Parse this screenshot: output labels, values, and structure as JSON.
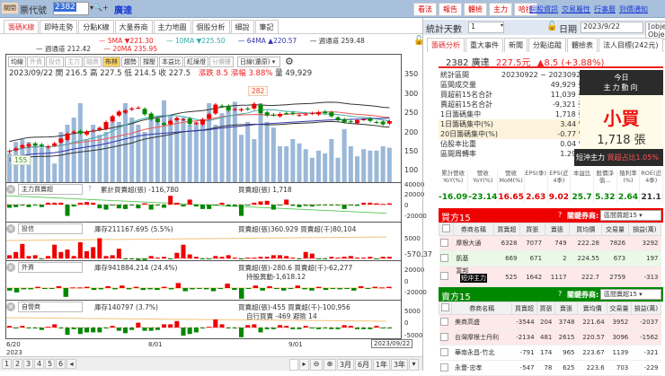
{
  "topbar": {
    "close_label": "關閉",
    "code_label": "票代號",
    "code_value": "2382",
    "stock_name": "廣達",
    "buttons": [
      "看法",
      "報告",
      "體檢",
      "主力",
      "哈拉"
    ],
    "links": [
      "個股資訊",
      "交易屬性",
      "行事曆",
      "到價通知"
    ]
  },
  "left_tabs": [
    "籌碼K線",
    "即時走勢",
    "分點K線",
    "大量券商",
    "主力地圖",
    "個股分析",
    "細說",
    "筆記"
  ],
  "ma_legend": {
    "ma5": "5MA ▼221.30",
    "ma10": "10MA ▼225.50",
    "ma64": "64MA ▲220.57",
    "upper": "週通道 259.48",
    "lower": "週通道 212.42",
    "ma20": "20MA 235.95"
  },
  "toolbar": {
    "buttons": [
      "均線",
      "外資",
      "投信",
      "主力",
      "融資",
      "布林",
      "趨勢",
      "撐壓",
      "本益比",
      "紅綠燈",
      "分價樓"
    ],
    "period": "日線(還原)"
  },
  "ohlc": {
    "date": "2023/09/22",
    "open_label": "開",
    "open": "216.5",
    "high_label": "高",
    "high": "227.5",
    "low_label": "低",
    "low": "214.5",
    "close_label": "收",
    "close": "227.5",
    "chg_label": "漲跌",
    "chg": "8.5",
    "pct_label": "漲幅",
    "pct": "3.88%",
    "vol_label": "量",
    "vol": "49,929"
  },
  "price_axis": [
    "350",
    "300",
    "250",
    "200",
    "150",
    "100"
  ],
  "markers": {
    "high": "282",
    "low": "155"
  },
  "chart_data": {
    "type": "candlestick",
    "ylim": [
      85,
      350
    ],
    "close": [
      150,
      157,
      165,
      168,
      165,
      163,
      162,
      170,
      182,
      195,
      200,
      196,
      200,
      203,
      210,
      225,
      240,
      252,
      255,
      260,
      262,
      245,
      232,
      225,
      218,
      228,
      235,
      232,
      220,
      222,
      232,
      245,
      270,
      265,
      255,
      258,
      258,
      258,
      272,
      248,
      242,
      243,
      246,
      247,
      246,
      243,
      245,
      248,
      250,
      248,
      240,
      230,
      225,
      225,
      230,
      232,
      228,
      224,
      219,
      227.5
    ],
    "volume": [
      20,
      28,
      30,
      28,
      26,
      24,
      25,
      13,
      35,
      40,
      45,
      55,
      30,
      40,
      33,
      35,
      45,
      42,
      55,
      45,
      40,
      35,
      45,
      45,
      57,
      47,
      45,
      45,
      40,
      42,
      42,
      55,
      40,
      48,
      52,
      56,
      33,
      42,
      30,
      55,
      42,
      38,
      25,
      25,
      30,
      27,
      23,
      17,
      22,
      20,
      30,
      17,
      37,
      25,
      18,
      23,
      22,
      22,
      25,
      24
    ],
    "xticks": [
      "6/20\n2023",
      "8/01",
      "9/01",
      "2023/09/22"
    ]
  },
  "sub": {
    "main": {
      "select": "主力買賣超",
      "legend1": "累計買賣超(張) -116,780",
      "legend2": "買賣超(張) 1,718",
      "axis": [
        "40000",
        "20000",
        "0",
        "-20000"
      ],
      "values": [
        -5,
        -4,
        0,
        -4,
        0,
        -4,
        3,
        3,
        3,
        -18,
        -3,
        3,
        4,
        3,
        -6,
        -8,
        0,
        -6,
        -7,
        0,
        -6,
        2,
        -8,
        0,
        -5,
        14,
        3,
        -3,
        8,
        -3,
        -7,
        -7,
        0,
        3,
        -3,
        -3,
        -18,
        0,
        3,
        5,
        6,
        -8,
        0,
        8,
        -2,
        -4,
        -2,
        -3,
        0,
        0,
        0,
        0,
        -7,
        0,
        -2,
        3,
        3,
        2,
        1,
        2
      ]
    },
    "trust": {
      "select": "投信",
      "legend1": "庫存211167.695 (5.5%)",
      "legend2": "買賣超(張)360.929 買賣超(千)80,104",
      "axis": [
        "5000",
        "-570.37"
      ],
      "values": [
        4,
        8,
        18,
        3,
        4,
        -1,
        3,
        17,
        8,
        11,
        3,
        20,
        9,
        14,
        25,
        3,
        4,
        12,
        -1,
        -1,
        -2,
        -2,
        3,
        1,
        2,
        -1,
        7,
        17,
        5,
        2,
        -1,
        -1,
        3,
        2,
        4,
        1,
        -1,
        1,
        1,
        2,
        2,
        4,
        4,
        3,
        1,
        -1,
        8,
        6,
        -1,
        -1,
        2,
        1,
        2,
        3,
        1,
        1,
        2,
        -1,
        2,
        2
      ]
    },
    "foreign": {
      "select": "外資",
      "legend1": "庫存941884.214 (24.4%)",
      "legend2": "買賣超(張)-280.6 買賣超(千)-62,277",
      "legend3": "持股異動-1,618.12",
      "axis": [
        "20000",
        "0",
        "-20000"
      ],
      "values": [
        -4,
        -7,
        -2,
        -2,
        2,
        0,
        -1,
        3,
        -14,
        1,
        1,
        2,
        -3,
        -2,
        3,
        -2,
        4,
        -2,
        2,
        -3,
        -2,
        -3,
        2,
        -2,
        8,
        -5,
        -2,
        0,
        -2,
        -5,
        -1,
        7,
        -3,
        -17,
        0,
        4,
        -4,
        3,
        -1,
        -4,
        0,
        4,
        -2,
        -4,
        2,
        -3,
        -1,
        -2,
        -1,
        -4,
        3,
        -1,
        2,
        1,
        2
      ]
    },
    "dealer": {
      "select": "自營商",
      "legend1": "庫存140797 (3.7%)",
      "legend2": "買賣超(張)-455 買賣超(千)-100,956",
      "legend3": "自行買賣 -469 避險 14",
      "axis": [
        "5000",
        "0",
        "-5000"
      ],
      "values": [
        2,
        -1,
        2,
        -1,
        -1,
        -3,
        1,
        4,
        -1,
        -9,
        -2,
        -8,
        -6,
        -6,
        -6,
        0,
        2,
        -4,
        -7,
        -3,
        6,
        -4,
        -4,
        -3,
        4,
        4,
        8,
        -10,
        -8,
        -6,
        0,
        1,
        10,
        4,
        0,
        -1,
        -12,
        3,
        4,
        -6,
        -2,
        -2,
        3,
        2,
        -2,
        -2,
        2,
        -1,
        -2,
        -1,
        -2,
        -2,
        3,
        2,
        -2,
        -2,
        -2,
        2,
        -1,
        -1
      ]
    }
  },
  "xaxis": {
    "start": "6/20\n2023",
    "mid1": "8/01",
    "mid2": "9/01",
    "end": "2023/09/22"
  },
  "bottom": {
    "pages": [
      "1",
      "2",
      "3",
      "4",
      "5",
      "6"
    ],
    "ranges": [
      "3月",
      "6月",
      "1年",
      "3年"
    ]
  },
  "right": {
    "days_label": "統計天數",
    "days_value": "1",
    "date_label": "日期",
    "date_value": "2023/9/22",
    "today": {
      "t1": "今日",
      "t2": "主力動向",
      "action": "小買",
      "amount": "1,718 張",
      "short_label": "短沖主力",
      "short_val": "買超占比1.05%"
    },
    "tabs": [
      "籌碼分析",
      "重大事件",
      "新聞",
      "分點追蹤",
      "體檢表",
      "法人目標(242元)"
    ],
    "title": {
      "code": "2382 廣達",
      "price": "227.5元",
      "chg": "▲8.5 (+3.88%)"
    },
    "stats": [
      [
        "統計區間",
        "20230922 ~ 20230922"
      ],
      [
        "區間成交量",
        "49,929 張"
      ],
      [
        "買超前15名合計",
        "11,039 張"
      ],
      [
        "賣超前15名合計",
        "-9,321 張"
      ],
      [
        "1日籌碼集中",
        "1,718 張"
      ],
      [
        "1日籌碼集中(%)",
        "3.44 %"
      ],
      [
        "20日籌碼集中(%)",
        "-0.77 %"
      ],
      [
        "佔股本比重",
        "0.04 %"
      ],
      [
        "區間周轉率",
        "1.29 %"
      ]
    ],
    "indicators": {
      "heads": [
        "累計營收YoY(%)",
        "營收YoY(%)",
        "營收MoM(%)",
        "EPS(季)",
        "EPS(近4季)",
        "本益比",
        "股價淨值...",
        "殖利率(%)",
        "ROE(近4季)"
      ],
      "vals": [
        "-16.09",
        "-23.14",
        "16.65",
        "2.63",
        "9.02",
        "25.7",
        "5.32",
        "2.64",
        "21.1"
      ]
    },
    "buy": {
      "title": "買方15",
      "key_label": "關鍵券商:",
      "select": "區間買超15",
      "cols": [
        "券商名稱",
        "買賣超",
        "買張",
        "賣張",
        "買均價",
        "交易量",
        "損益(萬)"
      ],
      "rows": [
        [
          "摩根大通",
          "6328",
          "7077",
          "749",
          "222.28",
          "7826",
          "3292"
        ],
        [
          "凱基",
          "669",
          "671",
          "2",
          "224.55",
          "673",
          "197"
        ],
        [
          "富邦",
          "525",
          "1642",
          "1117",
          "222.7",
          "2759",
          "-313"
        ]
      ],
      "tag": "短沖主力"
    },
    "sell": {
      "title": "賣方15",
      "key_label": "關鍵券商:",
      "select": "區間賣超15",
      "cols": [
        "券商名稱",
        "買賣超",
        "買張",
        "賣張",
        "賣均價",
        "交易量",
        "損益(萬)"
      ],
      "rows": [
        [
          "美商高盛",
          "-3544",
          "204",
          "3748",
          "221.64",
          "3952",
          "-2037"
        ],
        [
          "台灣摩根士丹利",
          "-2134",
          "481",
          "2615",
          "220.57",
          "3096",
          "-1562"
        ],
        [
          "華南永昌-竹北",
          "-791",
          "174",
          "965",
          "223.67",
          "1139",
          "-321"
        ],
        [
          "永豐-忠孝",
          "-547",
          "78",
          "625",
          "223.6",
          "703",
          "-229"
        ]
      ]
    }
  }
}
